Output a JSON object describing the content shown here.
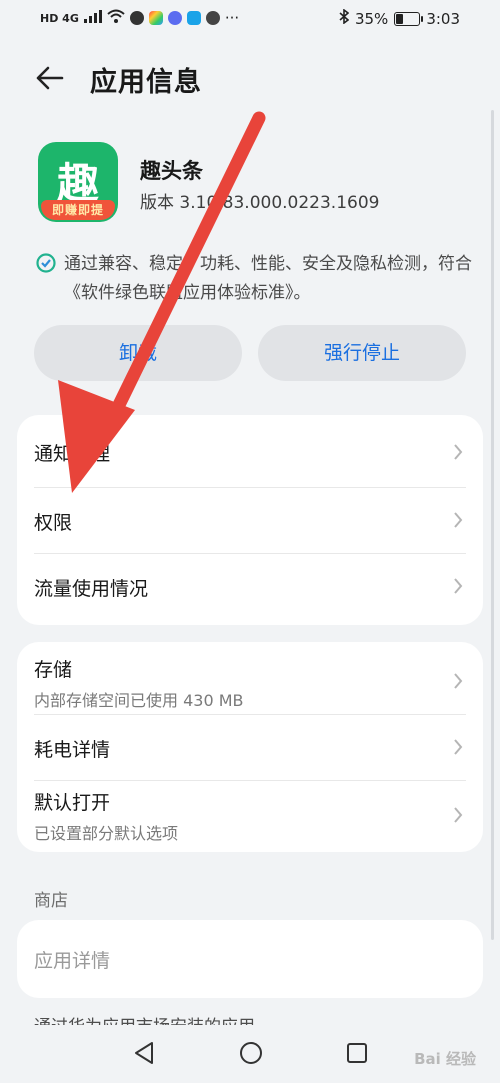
{
  "status_bar": {
    "signal_left": "HD 4G",
    "battery_percent": "35%",
    "battery_level": 0.35,
    "time": "3:03",
    "bluetooth_icon": "bluetooth-icon",
    "more": "···"
  },
  "header": {
    "title": "应用信息",
    "back_icon": "arrow-left-icon"
  },
  "app": {
    "name": "趣头条",
    "version": "版本 3.10.83.000.0223.1609",
    "icon_glyph": "趣",
    "icon_strip": "即赚即提",
    "icon_color": "#1db56b"
  },
  "check": {
    "text": "通过兼容、稳定、功耗、性能、安全及隐私检测，符合《软件绿色联盟应用体验标准》。"
  },
  "buttons": {
    "uninstall": "卸载",
    "force_stop": "强行停止"
  },
  "card1": {
    "notification": "通知管理",
    "permissions": "权限",
    "data_usage": "流量使用情况"
  },
  "card2": {
    "storage": "存储",
    "storage_sub": "内部存储空间已使用 430 MB",
    "battery": "耗电详情",
    "default_open": "默认打开",
    "default_open_sub": "已设置部分默认选项"
  },
  "store": {
    "section": "商店",
    "app_details": "应用详情",
    "footnote": "通过华为应用市场安装的应用"
  },
  "colors": {
    "accent": "#1a6fe0",
    "annotation": "#e8443a"
  },
  "watermark": "Bai 经验"
}
